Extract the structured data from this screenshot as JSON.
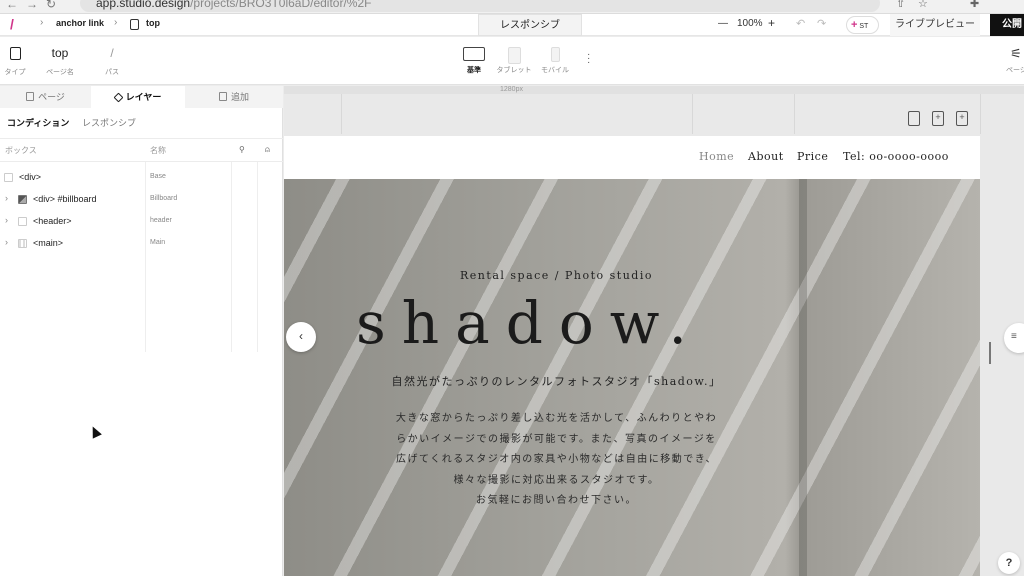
{
  "browser": {
    "url_host": "app.studio.design",
    "url_path": "/projects/BRO3T0l6aD/editor/%2F"
  },
  "topbar": {
    "crumb1": "anchor link",
    "crumb2": "top",
    "responsive_tab": "レスポンシブ",
    "zoom": "100%",
    "zoom_minus": "—",
    "zoom_plus": "+",
    "collab_label": "ST",
    "live_preview": "ライブプレビュー",
    "publish": "公開"
  },
  "propbar": {
    "type_label": "タイプ",
    "page_name_value": "top",
    "page_name_label": "ページ名",
    "path_value": "/",
    "path_label": "パス",
    "devices": [
      {
        "label": "基準",
        "active": true
      },
      {
        "label": "タブレット",
        "active": false
      },
      {
        "label": "モバイル",
        "active": false
      }
    ],
    "settings_label": "ページ設定"
  },
  "panel": {
    "tabs": [
      {
        "label": "ページ"
      },
      {
        "label": "レイヤー"
      },
      {
        "label": "追加"
      }
    ],
    "subtabs": [
      {
        "label": "コンディション"
      },
      {
        "label": "レスポンシブ"
      }
    ],
    "col_box": "ボックス",
    "col_name": "名称",
    "layers": [
      {
        "tag": "<div>",
        "name": "Base"
      },
      {
        "tag": "<div> #billboard",
        "name": "Billboard"
      },
      {
        "tag": "<header>",
        "name": "header"
      },
      {
        "tag": "<main>",
        "name": "Main"
      }
    ]
  },
  "canvas": {
    "ruler_label": "1280px",
    "nav": [
      {
        "label": "Home"
      },
      {
        "label": "About"
      },
      {
        "label": "Price"
      },
      {
        "label": "Tel: oo-oooo-oooo"
      }
    ],
    "hero": {
      "subtitle": "Rental space / Photo studio",
      "logo": "shadow.",
      "tagline": "自然光がたっぷりのレンタルフォトスタジオ「shadow.」",
      "body_lines": [
        "大きな窓からたっぷり差し込む光を活かして、ふんわりとやわ",
        "らかいイメージでの撮影が可能です。また、写真のイメージを",
        "広げてくれるスタジオ内の家具や小物などは自由に移動でき、",
        "様々な撮影に対応出来るスタジオです。",
        "お気軽にお問い合わせ下さい。"
      ]
    },
    "help": "?"
  }
}
